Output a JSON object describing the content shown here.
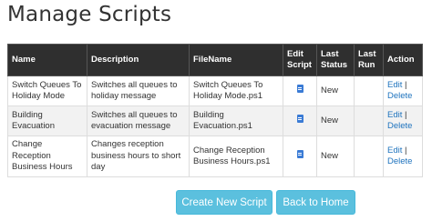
{
  "page": {
    "title": "Manage Scripts"
  },
  "table": {
    "headers": {
      "name": "Name",
      "description": "Description",
      "filename": "FileName",
      "edit_script_1": "Edit",
      "edit_script_2": "Script",
      "last_status_1": "Last",
      "last_status_2": "Status",
      "last_run_1": "Last",
      "last_run_2": "Run",
      "action": "Action"
    },
    "rows": [
      {
        "name": "Switch Queues To Holiday Mode",
        "description": "Switches all queues to holiday message",
        "filename": "Switch Queues To Holiday Mode.ps1",
        "icon": "document-icon",
        "last_status": "New",
        "last_run": "",
        "edit_label": "Edit",
        "separator": "|",
        "delete_label": "Delete"
      },
      {
        "name": "Building Evacuation",
        "description": "Switches all queues to evacuation message",
        "filename": "Building Evacuation.ps1",
        "icon": "document-icon",
        "last_status": "New",
        "last_run": "",
        "edit_label": "Edit",
        "separator": "|",
        "delete_label": "Delete"
      },
      {
        "name": "Change Reception Business Hours",
        "description": "Changes reception business hours to short day",
        "filename": "Change Reception Business Hours.ps1",
        "icon": "document-icon",
        "last_status": "New",
        "last_run": "",
        "edit_label": "Edit",
        "separator": "|",
        "delete_label": "Delete"
      }
    ]
  },
  "buttons": {
    "create": "Create New Script",
    "home": "Back to Home"
  },
  "colors": {
    "header_bg": "#2f2f2f",
    "link": "#1e73be",
    "button_bg": "#5bc0de",
    "icon": "#3a7bd5"
  }
}
